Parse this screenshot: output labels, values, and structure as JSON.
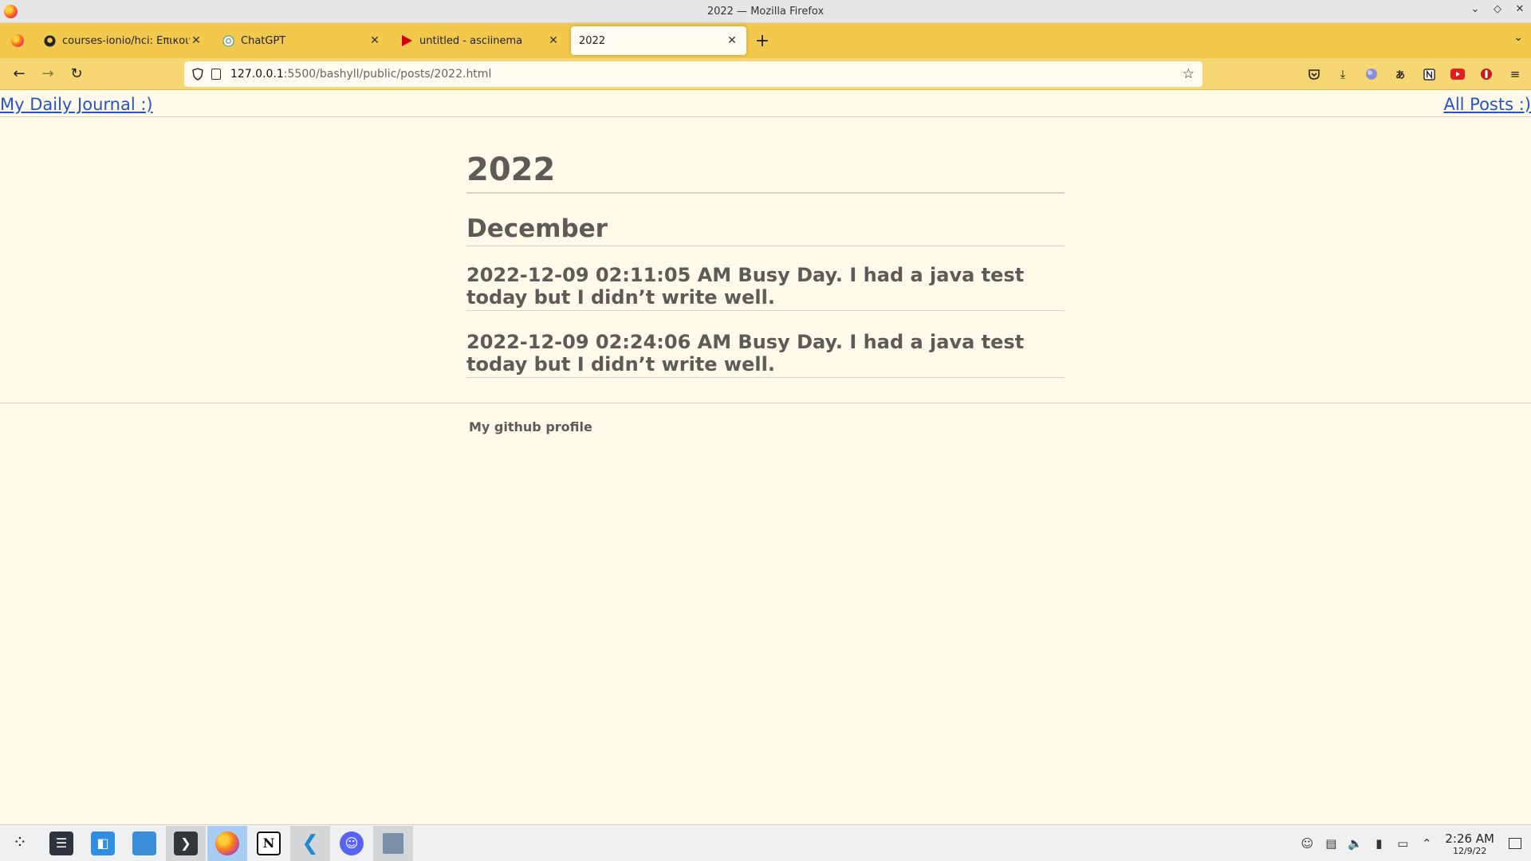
{
  "window": {
    "title": "2022 — Mozilla Firefox"
  },
  "tabs": [
    {
      "label": "courses-ionio/hci: Επικοινω",
      "icon": "github-icon",
      "active": false
    },
    {
      "label": "ChatGPT",
      "icon": "chatgpt-icon",
      "active": false
    },
    {
      "label": "untitled - asciinema",
      "icon": "asciinema-icon",
      "active": false
    },
    {
      "label": "2022",
      "icon": "",
      "active": true
    }
  ],
  "urlbar": {
    "host": "127.0.0.1",
    "path": ":5500/bashyll/public/posts/2022.html"
  },
  "site": {
    "home_link": "My Daily Journal :)",
    "all_posts_link": "All Posts :)"
  },
  "content": {
    "year": "2022",
    "month": "December",
    "posts": [
      {
        "title": "2022-12-09 02:11:05 AM Busy Day. I had a java test today but I didn’t write well."
      },
      {
        "title": "2022-12-09 02:24:06 AM Busy Day. I had a java test today but I didn’t write well."
      }
    ],
    "footer_link": "My github profile"
  },
  "taskbar": {
    "apps": [
      "launcher-icon",
      "system-settings-icon",
      "discover-store-icon",
      "file-manager-icon",
      "terminal-icon",
      "firefox-icon",
      "notion-icon",
      "vscode-icon",
      "discord-icon",
      "screenshot-app-icon"
    ],
    "time": "2:26 AM",
    "date": "12/9/22"
  },
  "colors": {
    "tabbar": "#f2c94c",
    "navbar": "#f7d774",
    "page_bg": "#fffae9",
    "link": "#2454c9",
    "text": "#5e5a55"
  }
}
